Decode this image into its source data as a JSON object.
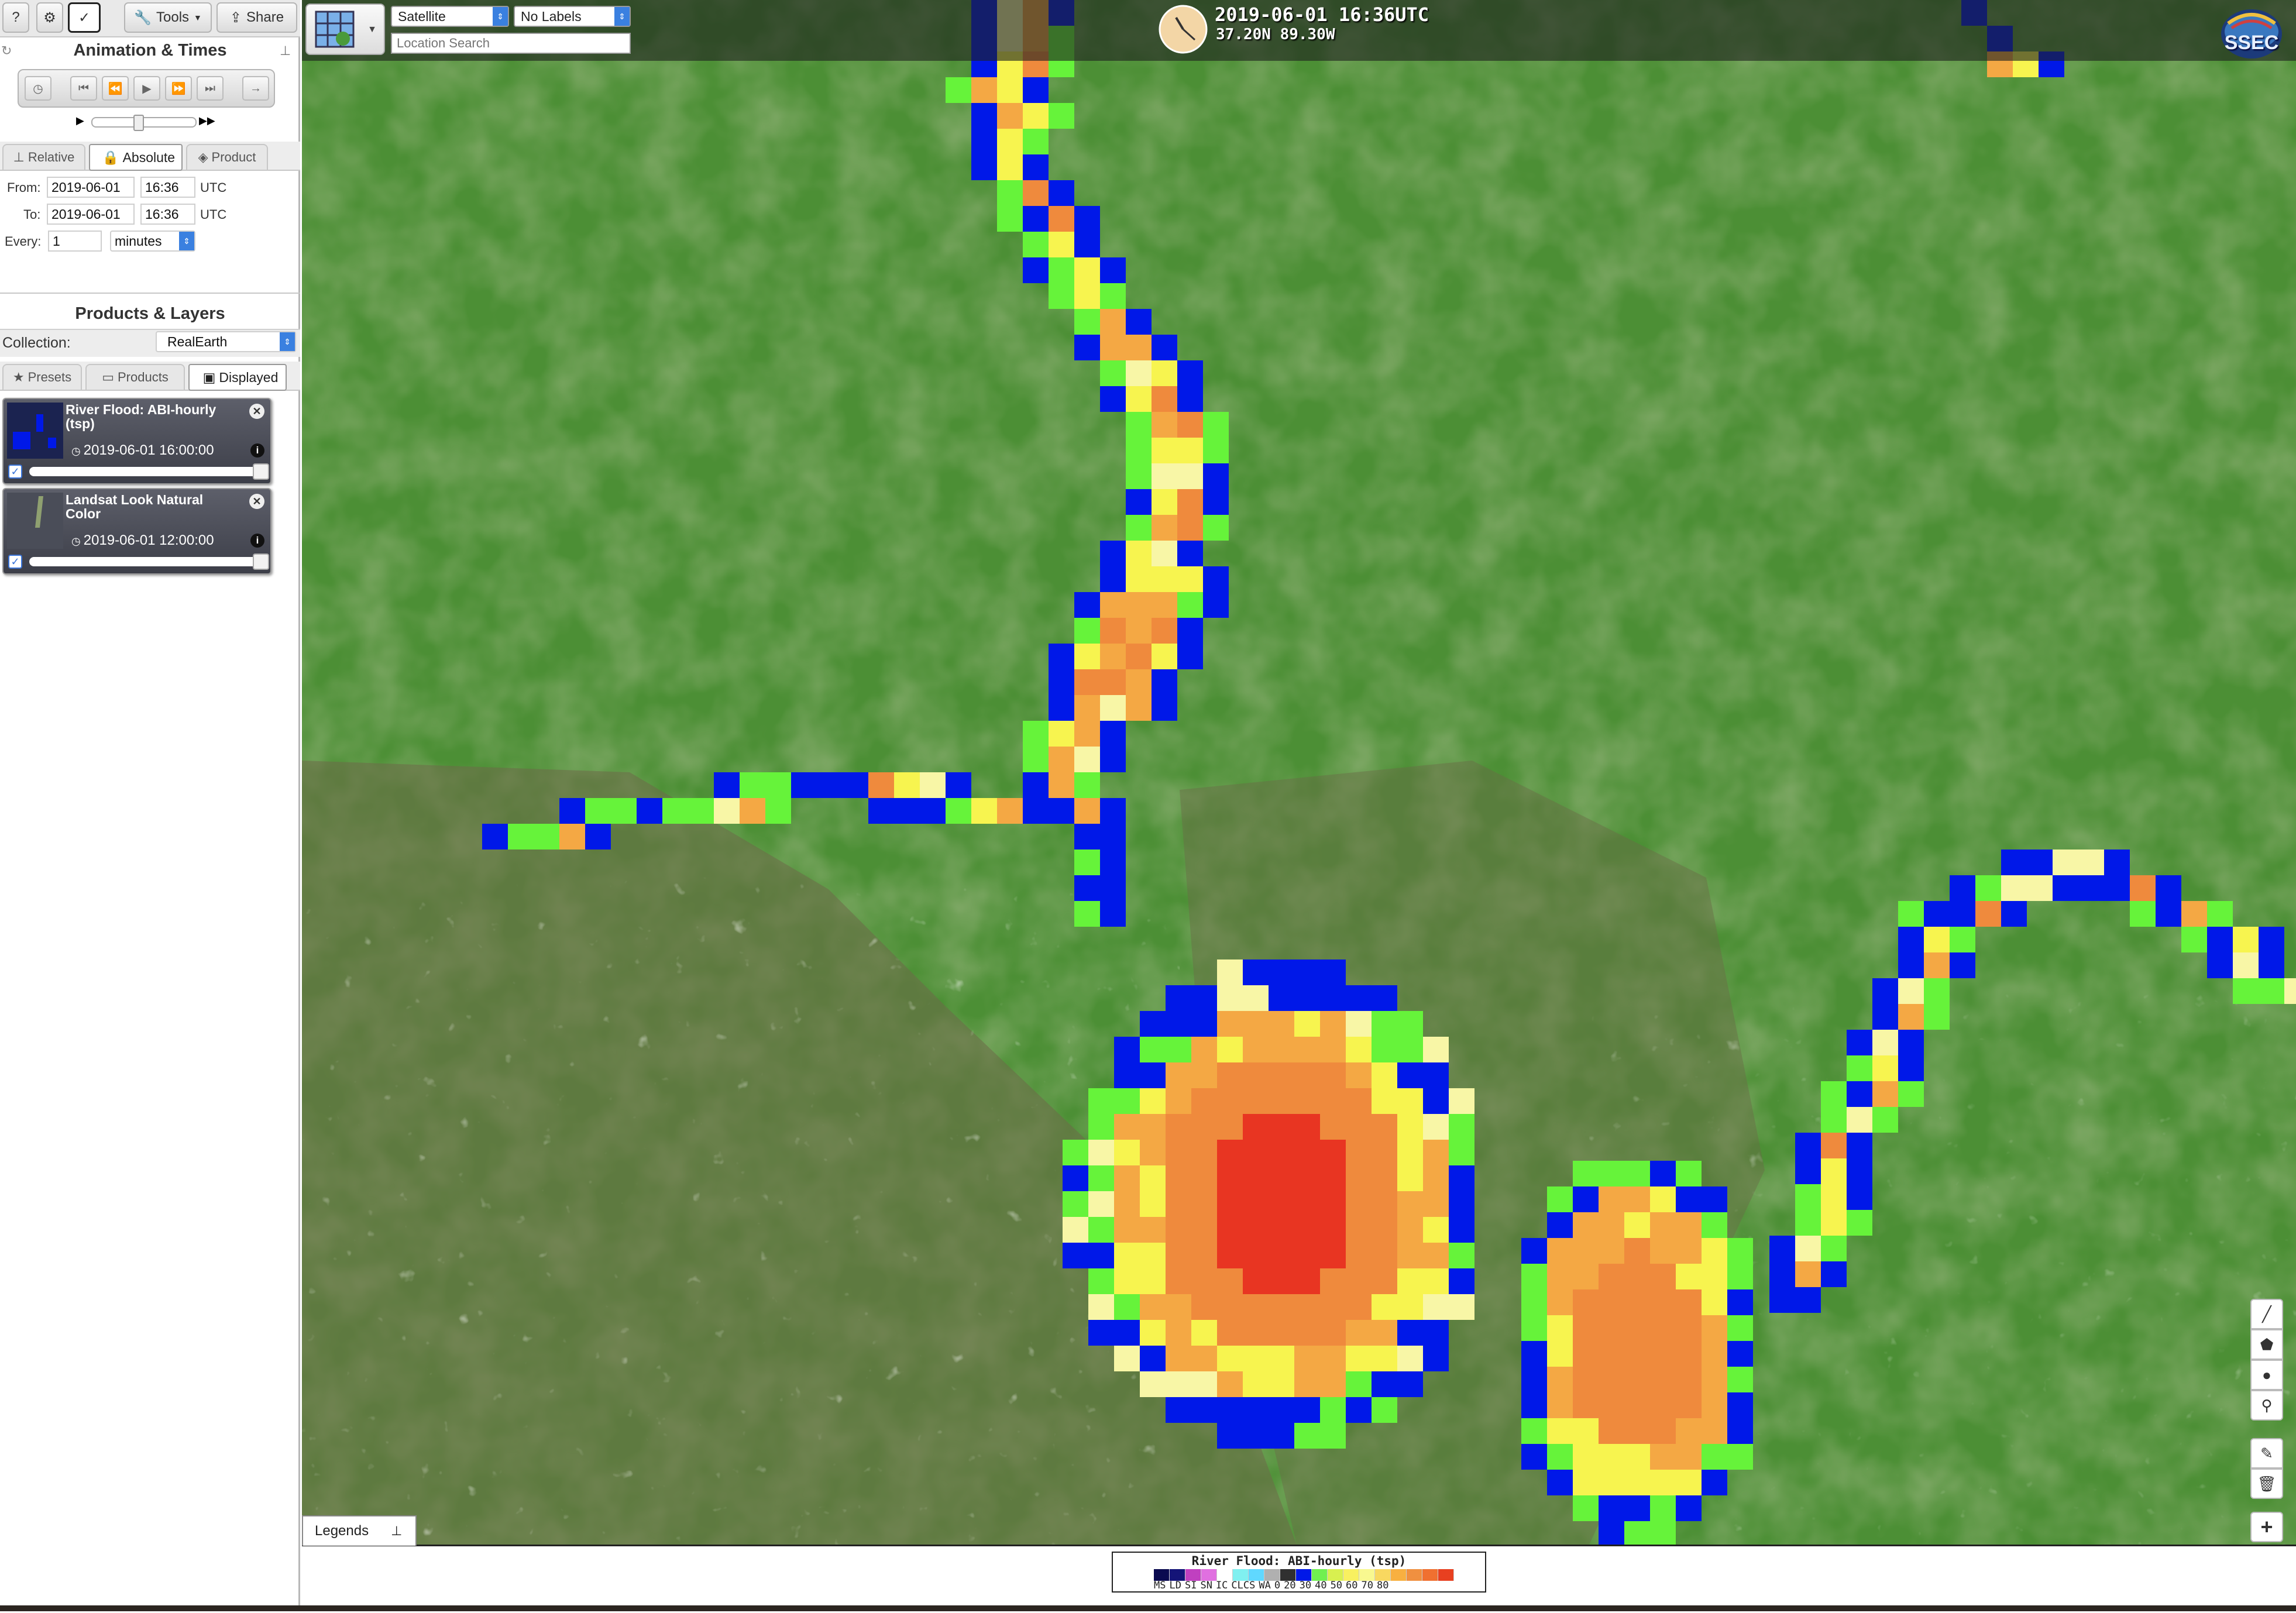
{
  "toolbar": {
    "help_label": "?",
    "settings_label": "⚙",
    "check_label": "✓",
    "tools_label": "Tools",
    "share_label": "Share"
  },
  "animation": {
    "title": "Animation & Times",
    "tabs": [
      "Relative",
      "Absolute",
      "Product"
    ],
    "selected_tab": "Absolute",
    "from_label": "From:",
    "from_date": "2019-06-01",
    "from_time": "16:36",
    "to_label": "To:",
    "to_date": "2019-06-01",
    "to_time": "16:36",
    "tz": "UTC",
    "every_label": "Every:",
    "every_value": "1",
    "every_unit": "minutes"
  },
  "products": {
    "title": "Products & Layers",
    "collection_label": "Collection:",
    "collection_value": "RealEarth",
    "tabs": [
      "Presets",
      "Products",
      "Displayed"
    ],
    "selected_tab": "Displayed",
    "layers": [
      {
        "name": "River Flood: ABI-hourly (tsp)",
        "time": "2019-06-01 16:00:00",
        "checked": true,
        "opacity": 1.0
      },
      {
        "name": "Landsat Look Natural Color",
        "time": "2019-06-01 12:00:00",
        "checked": true,
        "opacity": 1.0
      }
    ]
  },
  "map": {
    "basemap": "Satellite",
    "labels": "No Labels",
    "search_placeholder": "Location Search",
    "datetime": "2019-06-01 16:36UTC",
    "coords": "37.20N 89.30W",
    "logo": "SSEC",
    "legends_tab": "Legends",
    "zoom_in": "+"
  },
  "legend": {
    "title": "River Flood: ABI-hourly (tsp)",
    "labels": [
      "MS",
      "LD",
      "SI",
      "SN",
      "IC",
      "CLCS",
      "WA",
      "0",
      "20",
      "30",
      "40",
      "50",
      "60",
      "70",
      "80"
    ],
    "colors": [
      "#0a0a50",
      "#141478",
      "#c040c0",
      "#e070e0",
      "#ffffff",
      "#80f0f0",
      "#60d8ff",
      "#b0b0b0",
      "#303030",
      "#0018e8",
      "#70f050",
      "#d8f050",
      "#f8f060",
      "#f8f890",
      "#f8d860",
      "#f8b040",
      "#f09040",
      "#f07030",
      "#e84020"
    ]
  },
  "colors": {
    "flood_blue": "#0018e8",
    "flood_green": "#66f33a",
    "flood_yellow": "#f7f44f",
    "flood_pale": "#f8f6a6",
    "flood_orange": "#f4a844",
    "flood_darkorange": "#ef8a3d",
    "flood_red": "#e83522",
    "land": "#4c8f35"
  }
}
